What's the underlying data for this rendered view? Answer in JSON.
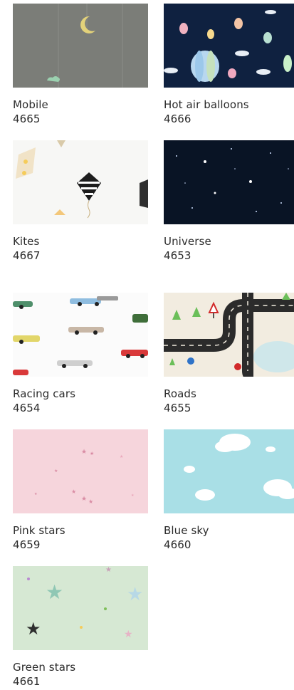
{
  "products": [
    {
      "title": "Mobile",
      "code": "4665",
      "bg": "#7b7d78"
    },
    {
      "title": "Hot air balloons",
      "code": "4666",
      "bg": "#0f2140"
    },
    {
      "title": "Kites",
      "code": "4667",
      "bg": "#f7f7f5"
    },
    {
      "title": "Universe",
      "code": "4653",
      "bg": "#091425"
    },
    {
      "title": "Racing cars",
      "code": "4654",
      "bg": "#fbfbfb"
    },
    {
      "title": "Roads",
      "code": "4655",
      "bg": "#f2ece0"
    },
    {
      "title": "Pink stars",
      "code": "4659",
      "bg": "#f6d5dc"
    },
    {
      "title": "Blue sky",
      "code": "4660",
      "bg": "#a9dfe6"
    },
    {
      "title": "Green stars",
      "code": "4661",
      "bg": "#d6e8d3"
    }
  ]
}
